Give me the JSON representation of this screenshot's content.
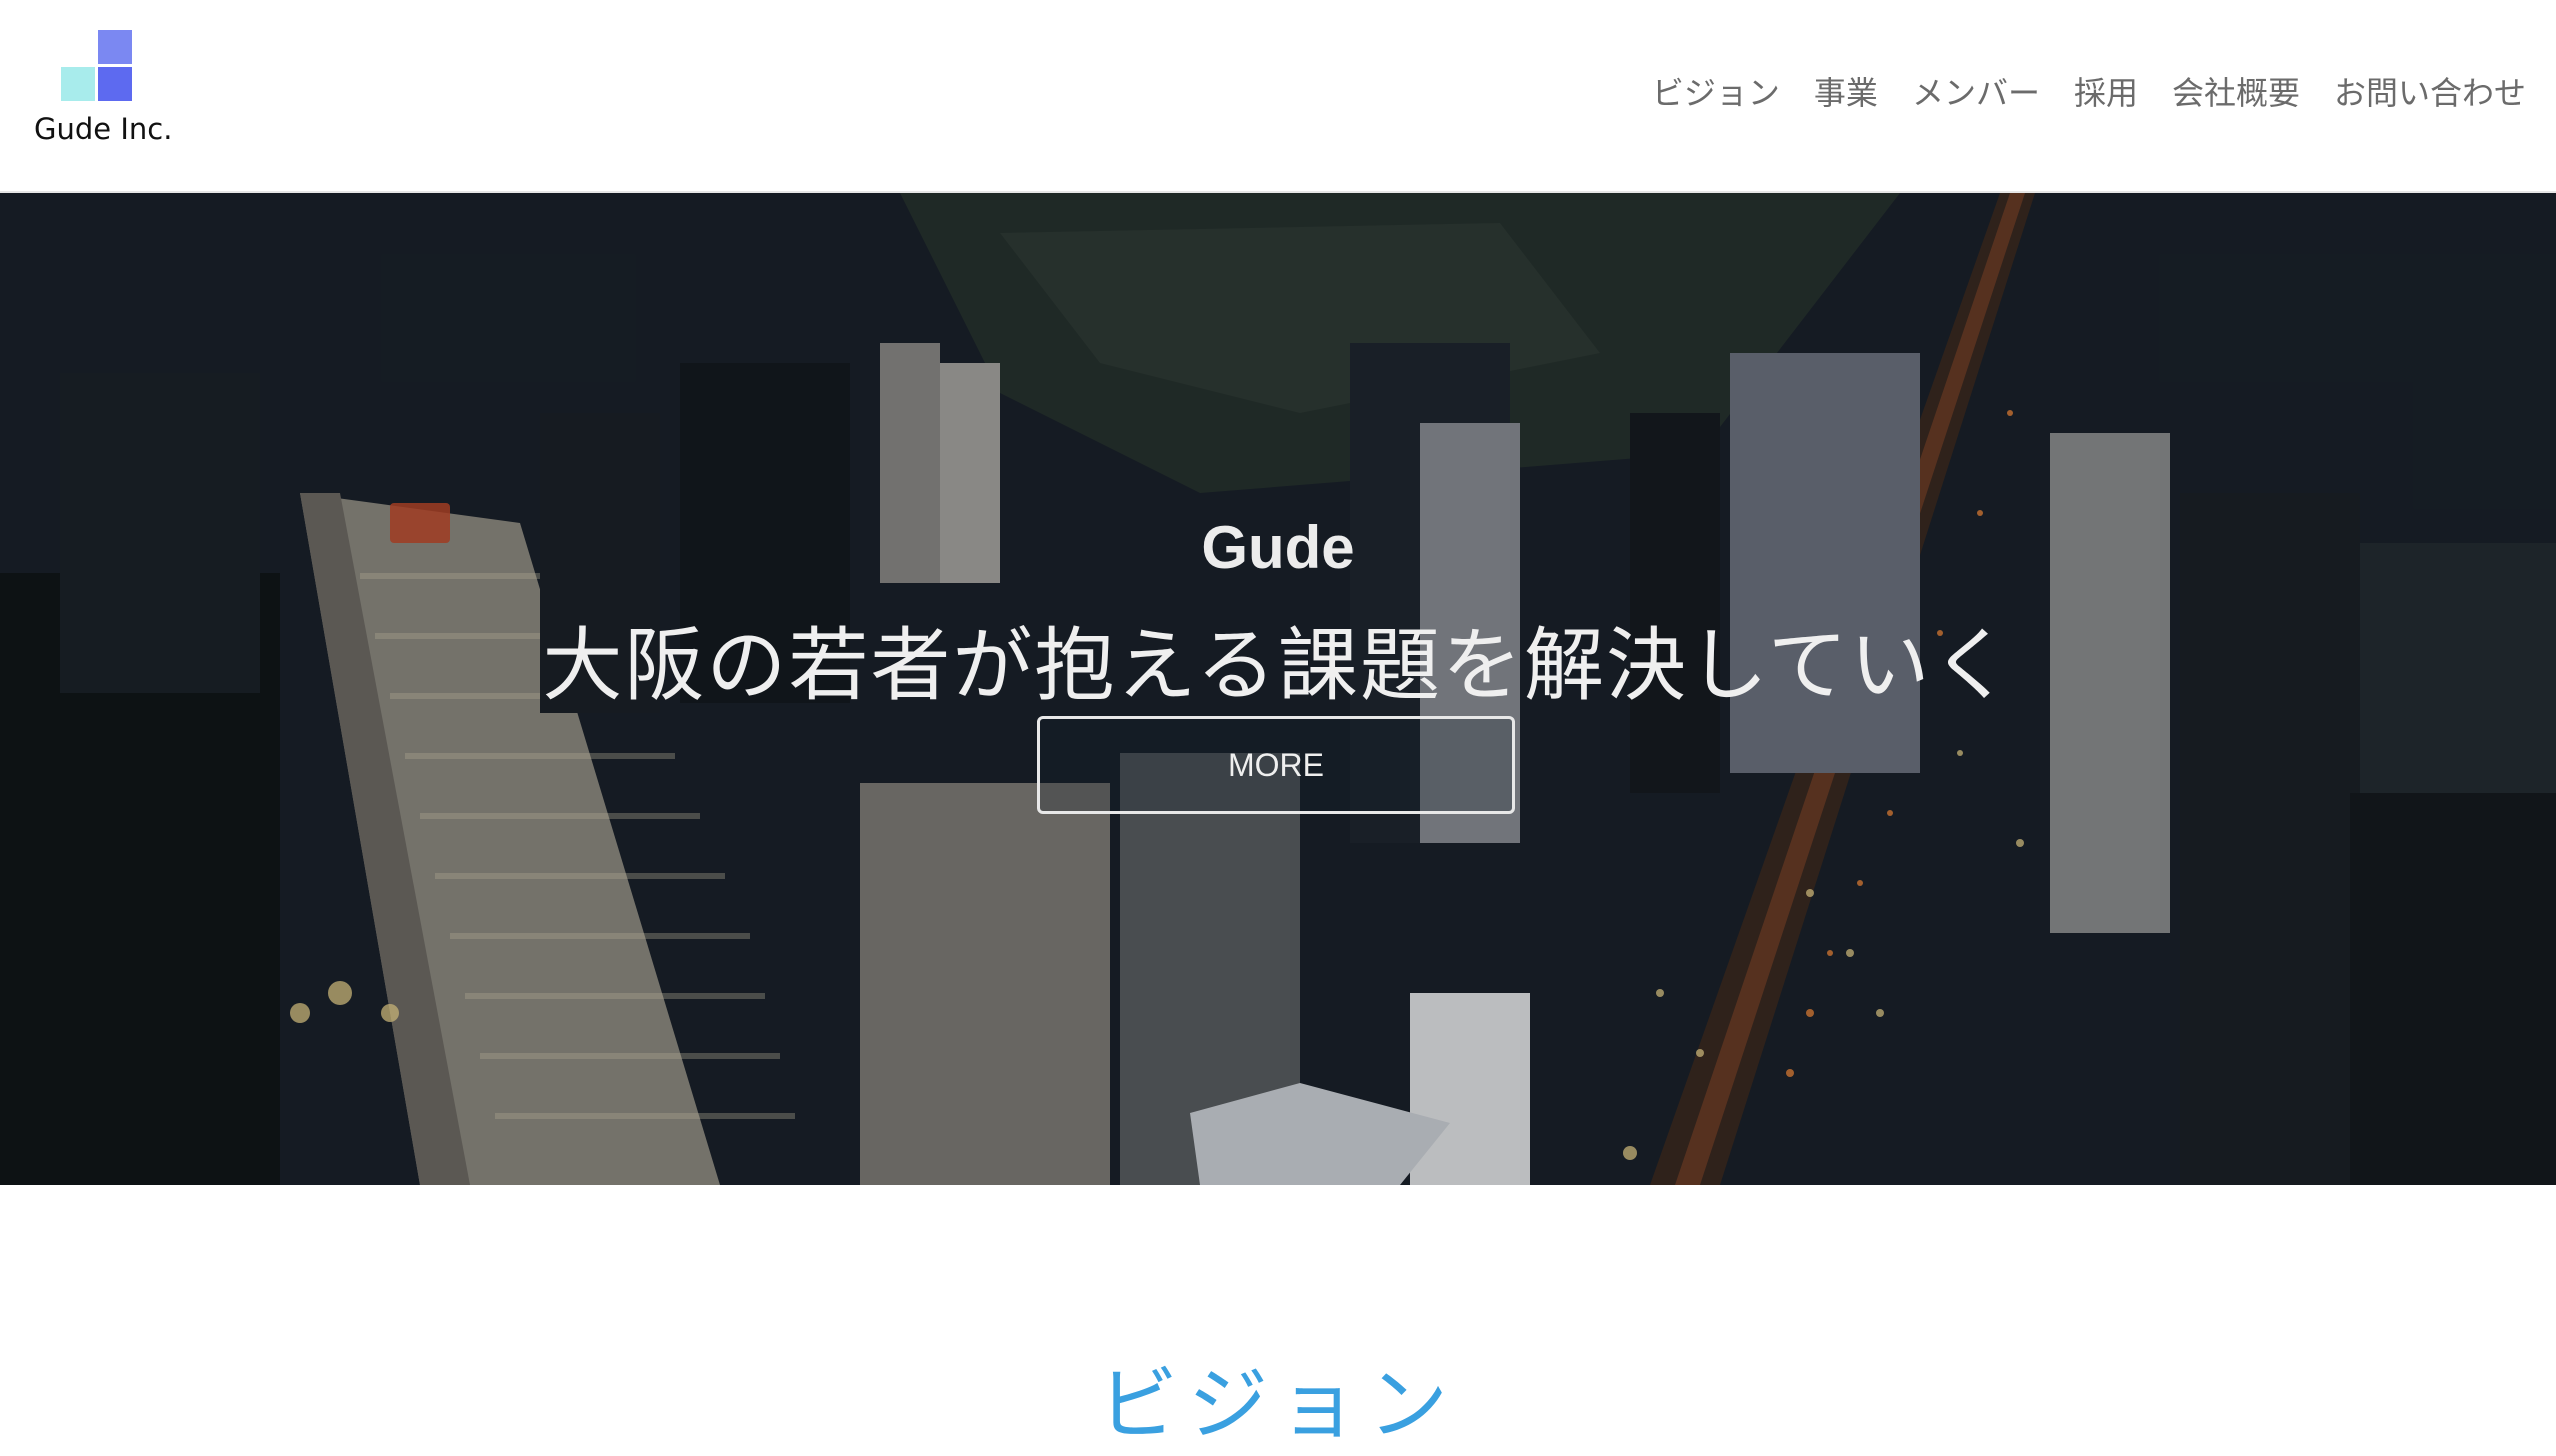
{
  "header": {
    "brand_name": "Gude Inc.",
    "logo_colors": {
      "top": "#7b88f2",
      "bottom_left": "#a8ecec",
      "bottom_right": "#5d6af0"
    },
    "nav": [
      {
        "label": "ビジョン"
      },
      {
        "label": "事業"
      },
      {
        "label": "メンバー"
      },
      {
        "label": "採用"
      },
      {
        "label": "会社概要"
      },
      {
        "label": "お問い合わせ"
      }
    ]
  },
  "hero": {
    "background_image": "aerial night city skyline",
    "title": "Gude",
    "tagline": "大阪の若者が抱える課題を解決していく",
    "button_label": "MORE"
  },
  "next_section": {
    "heading": "ビジョン",
    "heading_color": "#3aa0e0"
  }
}
